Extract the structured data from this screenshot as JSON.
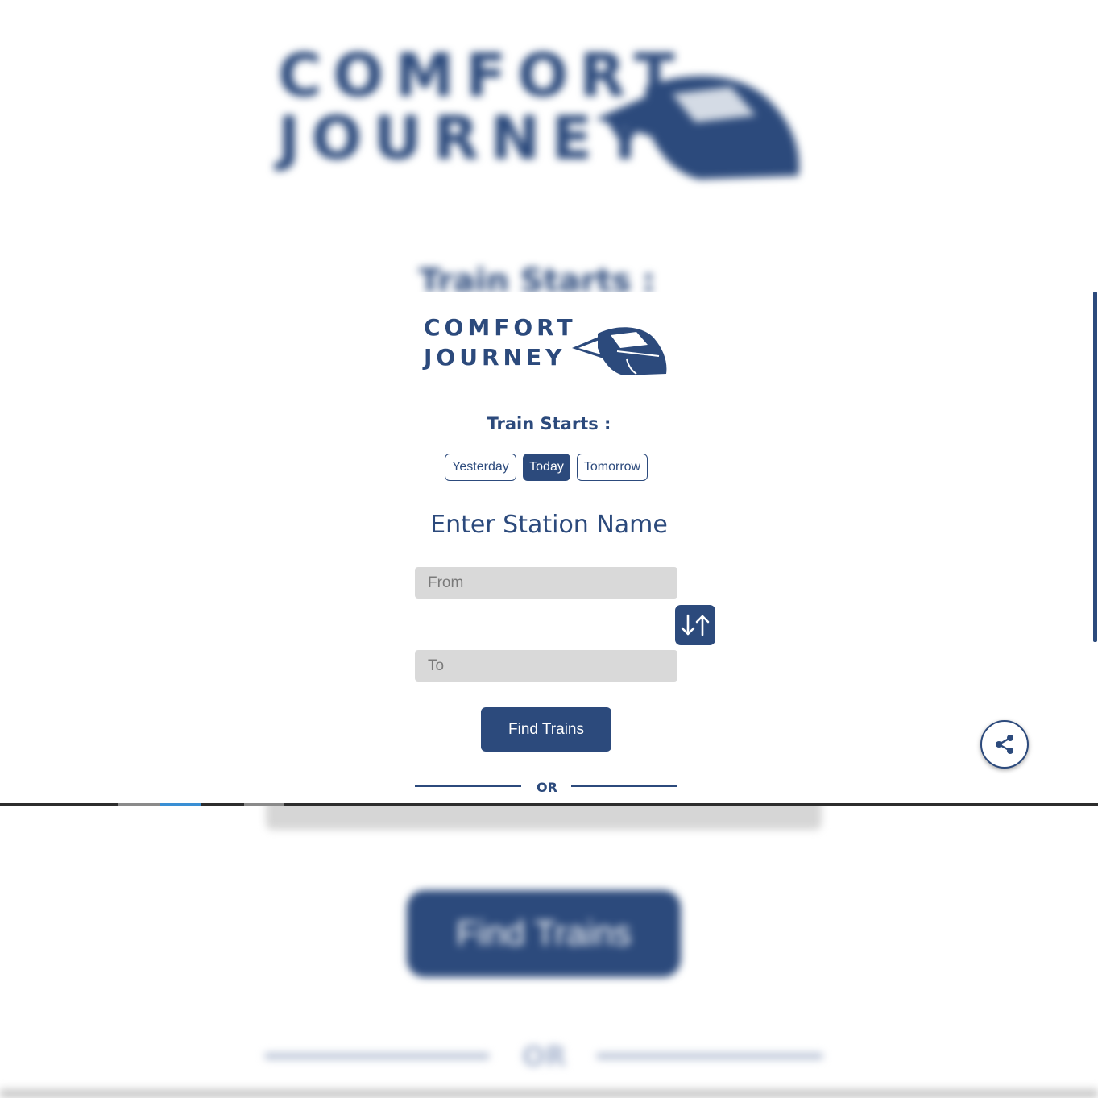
{
  "brand": {
    "line1": "COMFORT",
    "line2": "JOURNEY",
    "color": "#2c4a7c"
  },
  "background": {
    "heading": "Train Starts :",
    "button": "Find Trains",
    "or": "OR"
  },
  "train_starts": {
    "label": "Train Starts :",
    "options": [
      "Yesterday",
      "Today",
      "Tomorrow"
    ],
    "selected": "Today"
  },
  "station": {
    "title": "Enter Station Name",
    "from_placeholder": "From",
    "to_placeholder": "To",
    "swap_icon": "swap-vertical-icon"
  },
  "actions": {
    "find_trains": "Find Trains",
    "or": "OR",
    "share_icon": "share-icon"
  }
}
